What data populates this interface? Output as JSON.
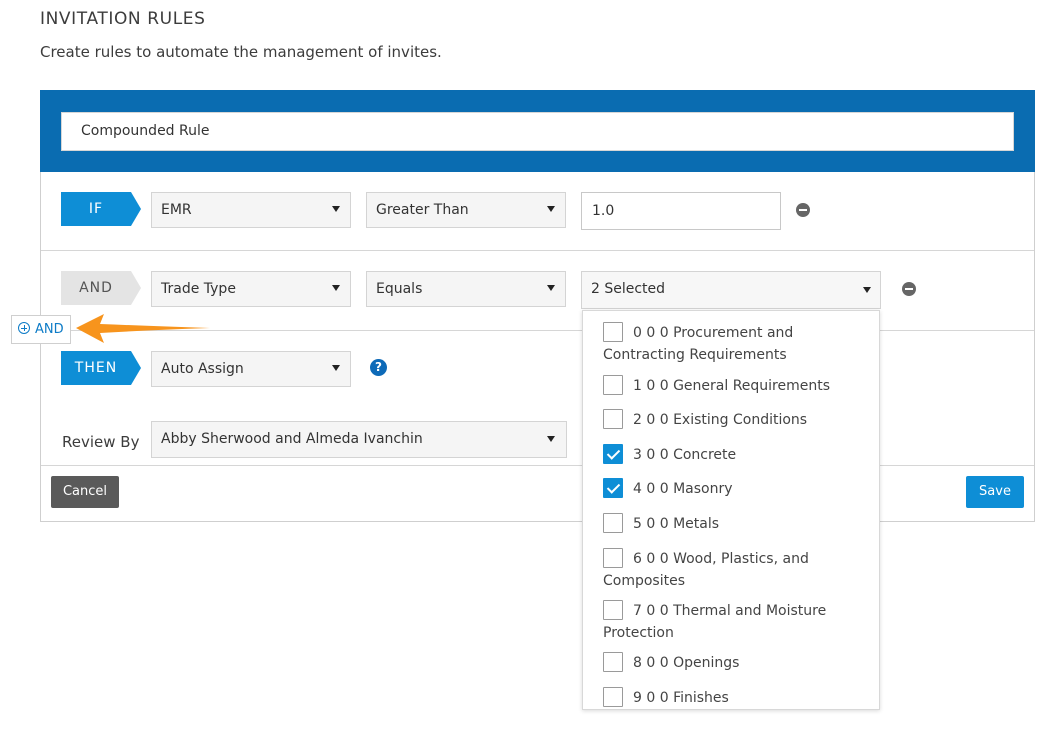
{
  "page": {
    "title": "INVITATION RULES",
    "subtitle": "Create rules to automate the management of invites."
  },
  "rule": {
    "name": "Compounded Rule",
    "if_row": {
      "tag": "IF",
      "field": "EMR",
      "operator": "Greater Than",
      "value": "1.0"
    },
    "and_row": {
      "tag": "AND",
      "field": "Trade Type",
      "operator": "Equals",
      "value": "2 Selected"
    },
    "add_and_label": "AND",
    "then_row": {
      "tag": "THEN",
      "action": "Auto Assign",
      "help_glyph": "?"
    },
    "review": {
      "label": "Review By",
      "value": "Abby Sherwood and Almeda Ivanchin"
    }
  },
  "actions": {
    "cancel_label": "Cancel",
    "save_label": "Save"
  },
  "dropdown": {
    "options": [
      {
        "label": "0 0 0 Procurement and Contracting Requirements",
        "checked": false
      },
      {
        "label": "1 0 0 General Requirements",
        "checked": false
      },
      {
        "label": "2 0 0 Existing Conditions",
        "checked": false
      },
      {
        "label": "3 0 0 Concrete",
        "checked": true
      },
      {
        "label": "4 0 0 Masonry",
        "checked": true
      },
      {
        "label": "5 0 0 Metals",
        "checked": false
      },
      {
        "label": "6 0 0 Wood, Plastics, and Composites",
        "checked": false
      },
      {
        "label": "7 0 0 Thermal and Moisture Protection",
        "checked": false
      },
      {
        "label": "8 0 0 Openings",
        "checked": false
      },
      {
        "label": "9 0 0 Finishes",
        "checked": false
      }
    ]
  },
  "colors": {
    "header_blue": "#0a6cb1",
    "accent_blue": "#0e8ed6",
    "annotation_arrow": "#f7941d",
    "cancel_gray": "#5a5a5a"
  }
}
